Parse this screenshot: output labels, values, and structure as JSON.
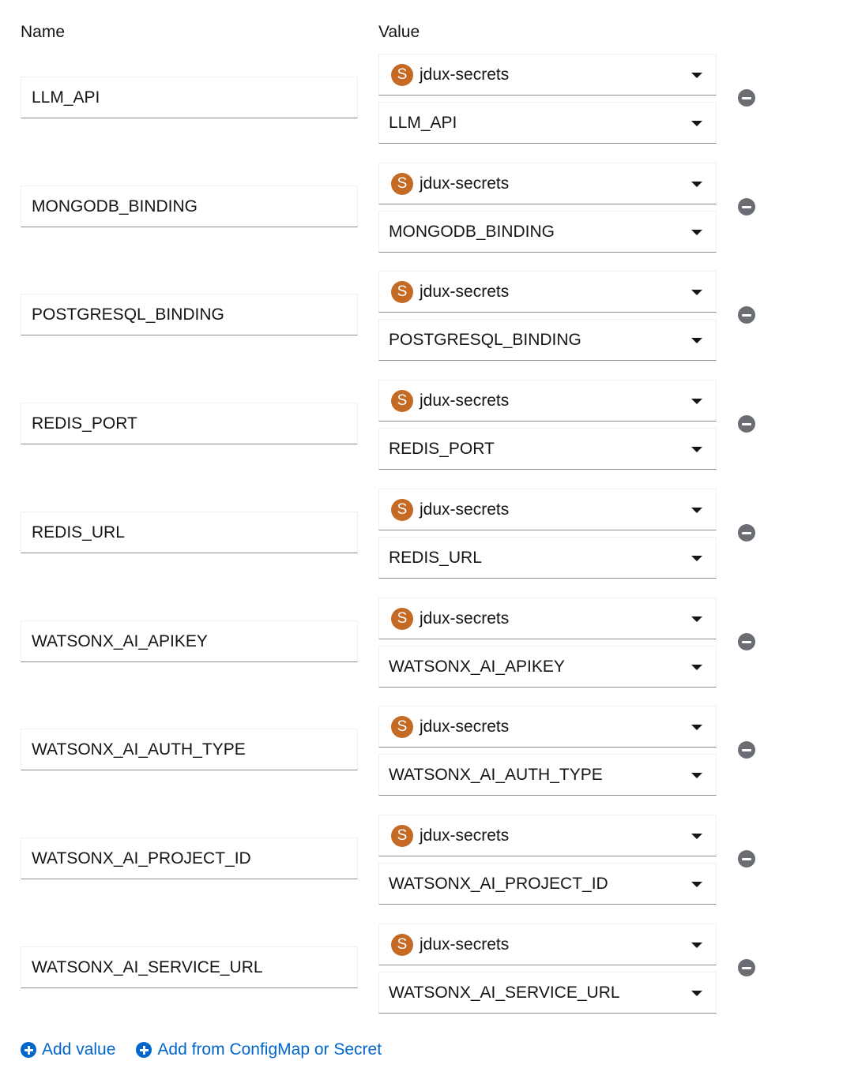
{
  "headers": {
    "name": "Name",
    "value": "Value"
  },
  "rows": [
    {
      "name": "LLM_API",
      "resource": "jdux-secrets",
      "resource_badge": "S",
      "key": "LLM_API"
    },
    {
      "name": "MONGODB_BINDING",
      "resource": "jdux-secrets",
      "resource_badge": "S",
      "key": "MONGODB_BINDING"
    },
    {
      "name": "POSTGRESQL_BINDING",
      "resource": "jdux-secrets",
      "resource_badge": "S",
      "key": "POSTGRESQL_BINDING"
    },
    {
      "name": "REDIS_PORT",
      "resource": "jdux-secrets",
      "resource_badge": "S",
      "key": "REDIS_PORT"
    },
    {
      "name": "REDIS_URL",
      "resource": "jdux-secrets",
      "resource_badge": "S",
      "key": "REDIS_URL"
    },
    {
      "name": "WATSONX_AI_APIKEY",
      "resource": "jdux-secrets",
      "resource_badge": "S",
      "key": "WATSONX_AI_APIKEY"
    },
    {
      "name": "WATSONX_AI_AUTH_TYPE",
      "resource": "jdux-secrets",
      "resource_badge": "S",
      "key": "WATSONX_AI_AUTH_TYPE"
    },
    {
      "name": "WATSONX_AI_PROJECT_ID",
      "resource": "jdux-secrets",
      "resource_badge": "S",
      "key": "WATSONX_AI_PROJECT_ID"
    },
    {
      "name": "WATSONX_AI_SERVICE_URL",
      "resource": "jdux-secrets",
      "resource_badge": "S",
      "key": "WATSONX_AI_SERVICE_URL"
    }
  ],
  "actions": {
    "add_value": "Add value",
    "add_from": "Add from ConfigMap or Secret"
  },
  "colors": {
    "secret_badge": "#c46a24",
    "link": "#0066cc",
    "remove_icon": "#6a6e73"
  }
}
